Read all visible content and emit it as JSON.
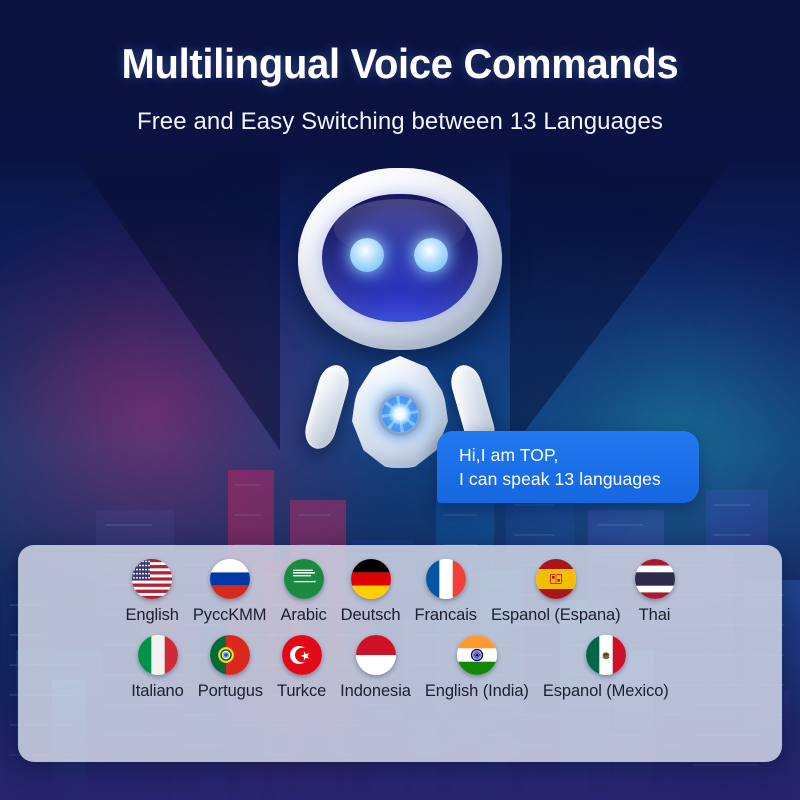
{
  "header": {
    "title": "Multilingual Voice Commands",
    "subtitle": "Free and Easy Switching between 13 Languages"
  },
  "robot": {
    "name": "TOP",
    "speech_bubble": {
      "line1": "Hi,I am TOP,",
      "line2": "I can speak 13 languages"
    }
  },
  "languages": {
    "count": 13,
    "row1": [
      {
        "label": "English",
        "flag": "us-flag-icon"
      },
      {
        "label": "PyccKMM",
        "flag": "ru-flag-icon"
      },
      {
        "label": "Arabic",
        "flag": "sa-flag-icon"
      },
      {
        "label": "Deutsch",
        "flag": "de-flag-icon"
      },
      {
        "label": "Francais",
        "flag": "fr-flag-icon"
      },
      {
        "label": "Espanol (Espana)",
        "flag": "es-flag-icon"
      },
      {
        "label": "Thai",
        "flag": "th-flag-icon"
      }
    ],
    "row2": [
      {
        "label": "Italiano",
        "flag": "it-flag-icon"
      },
      {
        "label": "Portugus",
        "flag": "pt-flag-icon"
      },
      {
        "label": "Turkce",
        "flag": "tr-flag-icon"
      },
      {
        "label": "Indonesia",
        "flag": "id-flag-icon"
      },
      {
        "label": "English (India)",
        "flag": "in-flag-icon"
      },
      {
        "label": "Espanol (Mexico)",
        "flag": "mx-flag-icon"
      }
    ]
  },
  "colors": {
    "background_deep": "#0a1340",
    "accent_magenta": "#d6286e",
    "accent_cyan": "#24b4c8",
    "bubble_blue": "#1a6ae8",
    "panel_grey": "#cdd3e2",
    "title_white": "#ffffff"
  }
}
